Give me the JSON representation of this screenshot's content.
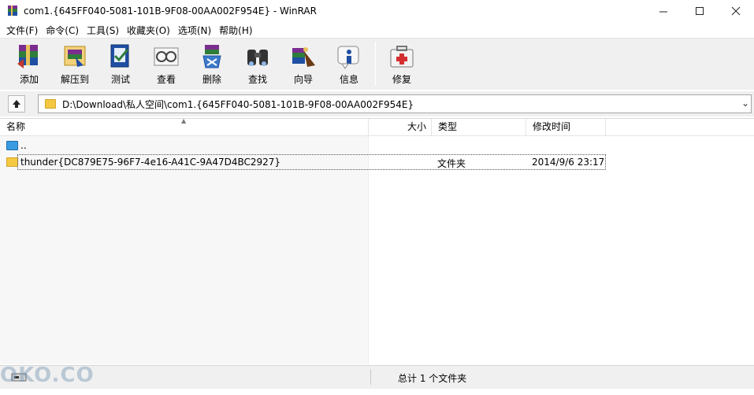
{
  "window": {
    "title": "com1.{645FF040-5081-101B-9F08-00AA002F954E} - WinRAR",
    "controls": [
      "minimize",
      "maximize",
      "close"
    ]
  },
  "menu": [
    "文件(F)",
    "命令(C)",
    "工具(S)",
    "收藏夹(O)",
    "选项(N)",
    "帮助(H)"
  ],
  "toolbar": {
    "buttons": [
      {
        "label": "添加",
        "icon": "add-archive-icon"
      },
      {
        "label": "解压到",
        "icon": "extract-to-icon"
      },
      {
        "label": "测试",
        "icon": "test-icon"
      },
      {
        "label": "查看",
        "icon": "view-icon"
      },
      {
        "label": "删除",
        "icon": "delete-icon"
      },
      {
        "label": "查找",
        "icon": "find-icon"
      },
      {
        "label": "向导",
        "icon": "wizard-icon"
      },
      {
        "label": "信息",
        "icon": "info-icon"
      },
      {
        "label": "修复",
        "icon": "repair-icon"
      }
    ]
  },
  "address": {
    "path": "D:\\Download\\私人空间\\com1.{645FF040-5081-101B-9F08-00AA002F954E}"
  },
  "columns": {
    "name": "名称",
    "size": "大小",
    "type": "类型",
    "modified": "修改时间"
  },
  "rows": [
    {
      "name": "..",
      "size": "",
      "type": "",
      "modified": "",
      "icon": "parent-folder-icon"
    },
    {
      "name": "thunder{DC879E75-96F7-4e16-A41C-9A47D4BC2927}",
      "size": "",
      "type": "文件夹",
      "modified": "2014/9/6 23:17",
      "icon": "folder-icon"
    }
  ],
  "status": {
    "summary": "总计 1 个文件夹"
  },
  "watermark": "OKO.CO",
  "colors": {
    "folder": "#f5c842",
    "toolbar_bg": "#f0f0f0",
    "name_column_bg": "#f7f7f7"
  }
}
